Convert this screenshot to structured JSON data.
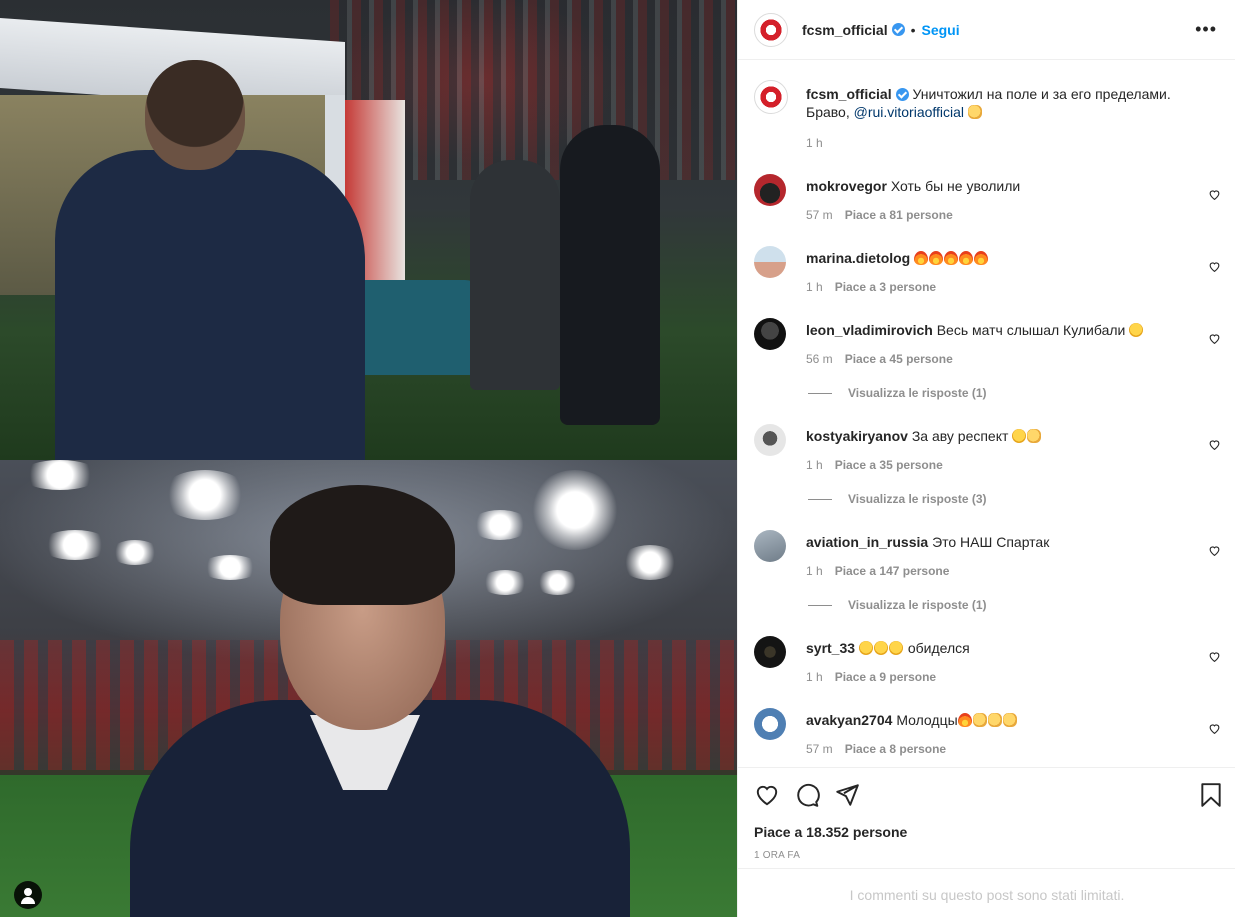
{
  "post": {
    "username": "fcsm_official",
    "separator": "•",
    "follow_label": "Segui",
    "more_label": "•••",
    "caption_text": "Уничтожил на поле и за его пределами. Браво,",
    "caption_mention": "@rui.vitoriaofficial",
    "caption_emoji": "clap",
    "caption_time": "1 h"
  },
  "comments": [
    {
      "user": "mokrovegor",
      "text": "Хоть бы не уволили",
      "emojis": [],
      "time": "57 m",
      "likes": "Piace a 81 persone",
      "replies": null,
      "avatar_color": "#b5272d"
    },
    {
      "user": "marina.dietolog",
      "text": "",
      "emojis": [
        "fire",
        "fire",
        "fire",
        "fire",
        "fire"
      ],
      "time": "1 h",
      "likes": "Piace a 3 persone",
      "replies": null,
      "avatar_color": "#9ab3c8"
    },
    {
      "user": "leon_vladimirovich",
      "text": "Весь матч слышал Кулибали",
      "emojis": [
        "laugh"
      ],
      "time": "56 m",
      "likes": "Piace a 45 persone",
      "replies": "Visualizza le risposte (1)",
      "avatar_color": "#1c1c1c"
    },
    {
      "user": "kostyakiryanov",
      "text": "За аву респект",
      "emojis": [
        "laugh",
        "clap"
      ],
      "time": "1 h",
      "likes": "Piace a 35 persone",
      "replies": "Visualizza le risposte (3)",
      "avatar_color": "#d9d9d9"
    },
    {
      "user": "aviation_in_russia",
      "text": "Это НАШ Спартак",
      "emojis": [],
      "time": "1 h",
      "likes": "Piace a 147 persone",
      "replies": "Visualizza le risposte (1)",
      "avatar_color": "#8a96a3"
    },
    {
      "user": "syrt_33",
      "text": "обиделся",
      "emojis_before": [
        "laugh",
        "laugh",
        "laugh"
      ],
      "emojis": [],
      "time": "1 h",
      "likes": "Piace a 9 persone",
      "replies": null,
      "avatar_color": "#151515"
    },
    {
      "user": "avakyan2704",
      "text": "Молодцы",
      "emojis": [
        "fire",
        "clap",
        "clap",
        "clap"
      ],
      "time": "57 m",
      "likes": "Piace a 8 persone",
      "replies": null,
      "avatar_color": "#4f7fb3"
    }
  ],
  "footer": {
    "likes_total": "Piace a 18.352 persone",
    "time_ago": "1 ORA FA",
    "limited_notice": "I commenti su questo post sono stati limitati."
  },
  "icons": {
    "like": "heart-icon",
    "comment": "comment-icon",
    "share": "share-icon",
    "save": "bookmark-icon",
    "tagged_user": "user-tag-icon"
  },
  "colors": {
    "follow": "#0095f6",
    "verified": "#3897f0",
    "muted": "#8e8e8e",
    "mention": "#00376b"
  }
}
